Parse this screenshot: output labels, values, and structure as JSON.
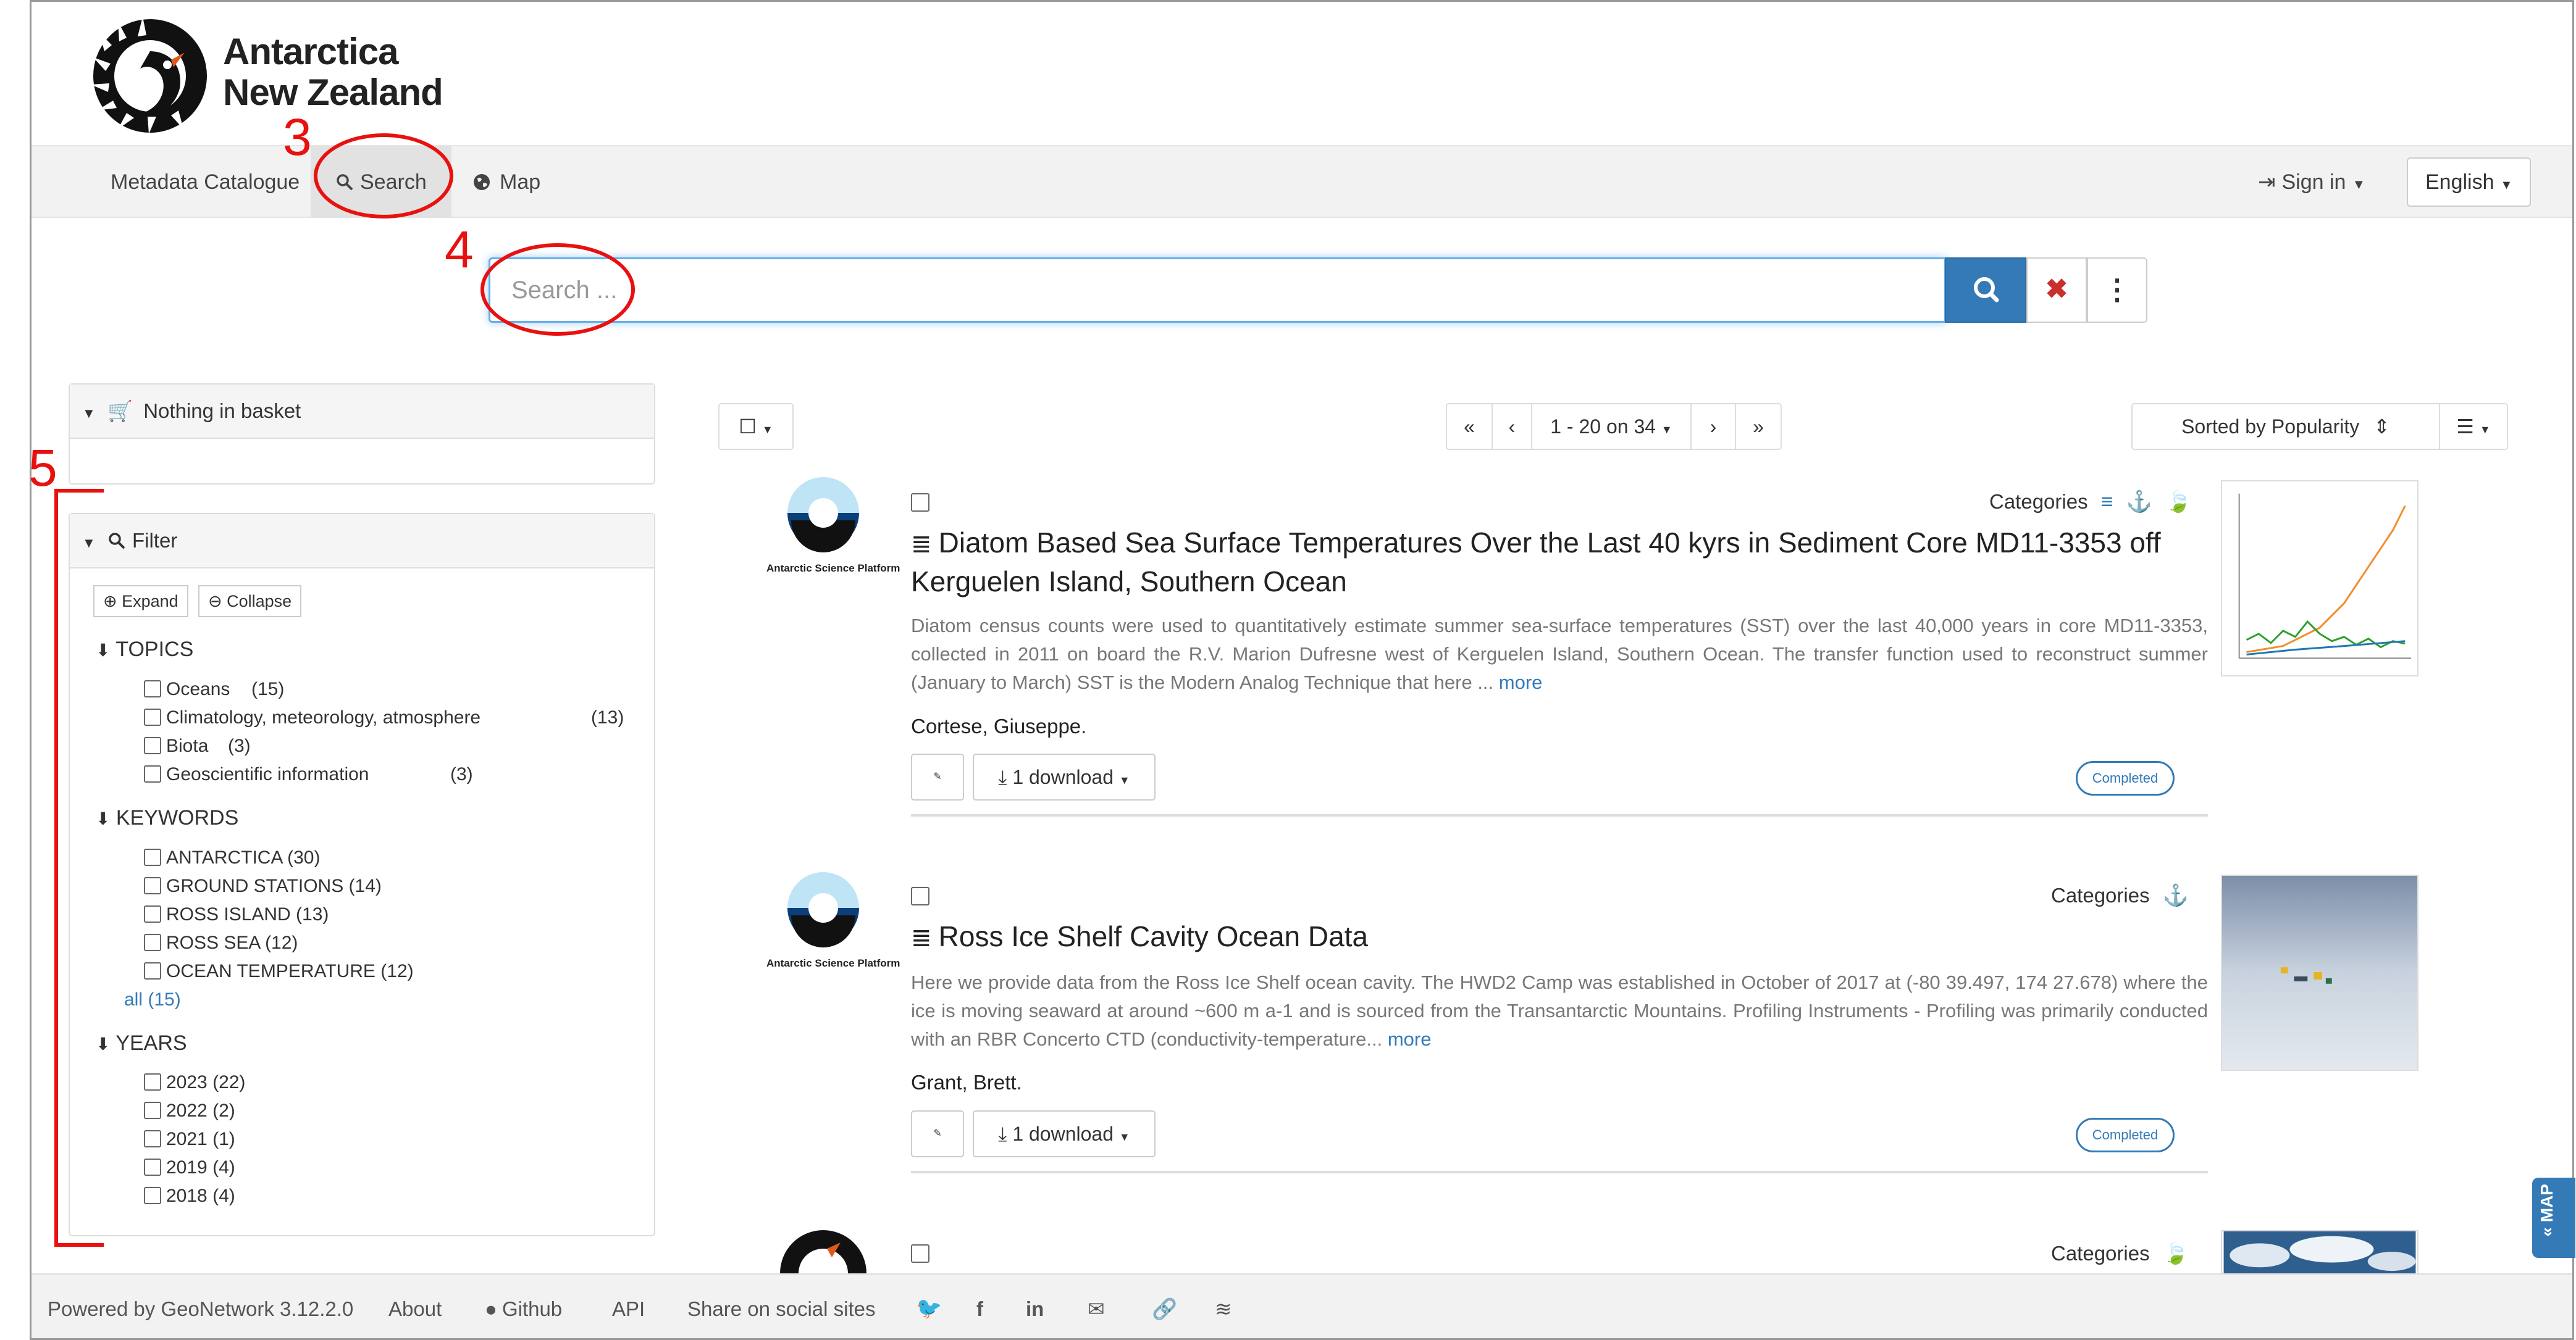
{
  "brand": {
    "line1": "Antarctica",
    "line2": "New Zealand"
  },
  "nav": {
    "catalogue": "Metadata Catalogue",
    "search": "Search",
    "map": "Map",
    "sign_in": "Sign in",
    "language": "English"
  },
  "search": {
    "placeholder": "Search ..."
  },
  "basket": {
    "label": "Nothing in basket"
  },
  "filter": {
    "label": "Filter",
    "expand": "Expand",
    "collapse": "Collapse",
    "topics": {
      "title": "TOPICS",
      "items": [
        {
          "label": "Oceans",
          "count": "(15)"
        },
        {
          "label": "Climatology, meteorology, atmosphere",
          "count": "(13)"
        },
        {
          "label": "Biota",
          "count": "(3)"
        },
        {
          "label": "Geoscientific information",
          "count": "(3)"
        }
      ]
    },
    "keywords": {
      "title": "KEYWORDS",
      "items": [
        {
          "label": "ANTARCTICA (30)"
        },
        {
          "label": "GROUND STATIONS (14)"
        },
        {
          "label": "ROSS ISLAND (13)"
        },
        {
          "label": "ROSS SEA (12)"
        },
        {
          "label": "OCEAN TEMPERATURE (12)"
        }
      ],
      "all": "all (15)"
    },
    "years": {
      "title": "YEARS",
      "items": [
        {
          "label": "2023 (22)"
        },
        {
          "label": "2022 (2)"
        },
        {
          "label": "2021 (1)"
        },
        {
          "label": "2019 (4)"
        },
        {
          "label": "2018 (4)"
        }
      ]
    }
  },
  "pagination": {
    "range": "1 - 20 on 34"
  },
  "sort": {
    "label": "Sorted by Popularity"
  },
  "results": [
    {
      "categories": "Categories",
      "title": "Diatom Based Sea Surface Temperatures Over the Last 40 kyrs in Sediment Core MD11-3353 off Kerguelen Island, Southern Ocean",
      "abstract": "Diatom census counts were used to quantitatively estimate summer sea-surface temperatures (SST) over the last 40,000 years in core MD11-3353, collected in 2011 on board the R.V. Marion Dufresne west of Kerguelen Island, Southern Ocean. The transfer function used to reconstruct summer (January to March) SST is the Modern Analog Technique that here ...",
      "more": "more",
      "author": "Cortese, Giuseppe.",
      "download": "1 download",
      "status": "Completed",
      "org": "Antarctic Science Platform"
    },
    {
      "categories": "Categories",
      "title": "Ross Ice Shelf Cavity Ocean Data",
      "abstract": "Here we provide data from the Ross Ice Shelf ocean cavity. The HWD2 Camp was established in October of 2017 at (-80 39.497, 174 27.678) where the ice is moving seaward at around ~600 m a-1 and is sourced from the Transantarctic Mountains. Profiling Instruments - Profiling was primarily conducted with an RBR Concerto CTD (conductivity-temperature...",
      "more": "more",
      "author": "Grant, Brett.",
      "download": "1 download",
      "status": "Completed",
      "org": "Antarctic Science Platform"
    },
    {
      "categories": "Categories"
    }
  ],
  "footer": {
    "powered": "Powered by GeoNetwork 3.12.2.0",
    "about": "About",
    "github": "Github",
    "api": "API",
    "share": "Share on social sites"
  },
  "map_tab": "MAP",
  "annotations": [
    "3",
    "4",
    "5"
  ],
  "colors": {
    "accent": "#337ab7",
    "annotation": "#e8110f",
    "navbar": "#f2f2f2"
  }
}
